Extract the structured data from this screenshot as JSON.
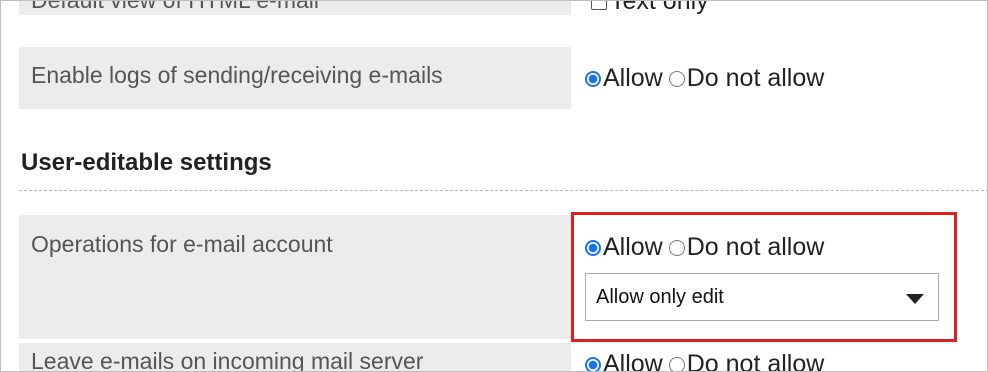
{
  "rows": {
    "html_view": {
      "label": "Default view of HTML e-mail",
      "checkbox_label": "Text only"
    },
    "logs": {
      "label": "Enable logs of sending/receiving e-mails",
      "allow_label": "Allow",
      "deny_label": "Do not allow",
      "selected": "Allow"
    },
    "account_ops": {
      "label": "Operations for e-mail account",
      "allow_label": "Allow",
      "deny_label": "Do not allow",
      "selected": "Allow",
      "dropdown_value": "Allow only edit"
    },
    "leave_mails": {
      "label": "Leave e-mails on incoming mail server",
      "allow_label": "Allow",
      "deny_label": "Do not allow",
      "selected": "Allow"
    }
  },
  "section": {
    "title": "User-editable settings"
  },
  "colors": {
    "highlight": "#e0201e",
    "radio_selected": "#1a73e8",
    "label_background": "#ececec"
  }
}
